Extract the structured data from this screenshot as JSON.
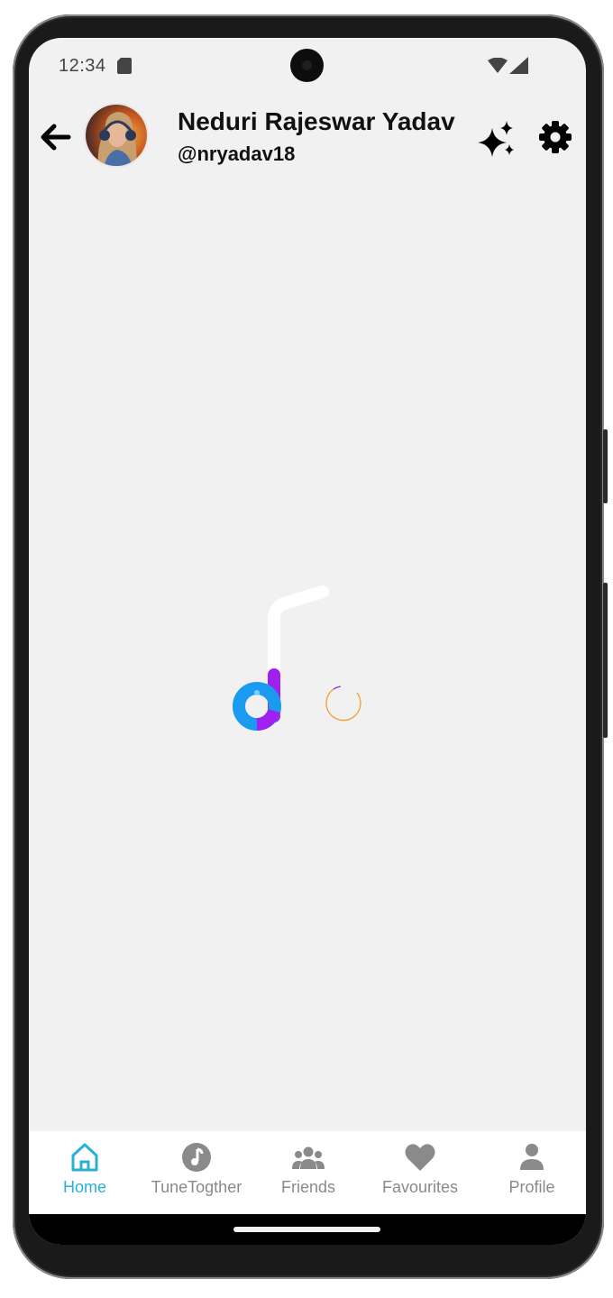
{
  "status_bar": {
    "time": "12:34"
  },
  "header": {
    "user_name": "Neduri Rajeswar Yadav",
    "user_handle": "@nryadav18"
  },
  "loader": {
    "colors": {
      "blue": "#1a9bf0",
      "purple": "#a020f0",
      "white": "#ffffff",
      "spinner_orange": "#f0a030",
      "spinner_purple": "#6a3cf0"
    }
  },
  "bottom_nav": {
    "active_color": "#2ab0d4",
    "inactive_color": "#8a8a8a",
    "items": [
      {
        "label": "Home",
        "icon": "home-icon",
        "active": true
      },
      {
        "label": "TuneTogther",
        "icon": "music-note-icon",
        "active": false
      },
      {
        "label": "Friends",
        "icon": "users-icon",
        "active": false
      },
      {
        "label": "Favourites",
        "icon": "heart-icon",
        "active": false
      },
      {
        "label": "Profile",
        "icon": "person-icon",
        "active": false
      }
    ]
  }
}
